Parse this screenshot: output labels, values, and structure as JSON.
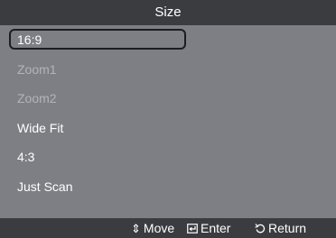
{
  "title": "Size",
  "items": [
    {
      "label": "16:9",
      "state": "selected"
    },
    {
      "label": "Zoom1",
      "state": "disabled"
    },
    {
      "label": "Zoom2",
      "state": "disabled"
    },
    {
      "label": "Wide Fit",
      "state": "enabled"
    },
    {
      "label": "4:3",
      "state": "enabled"
    },
    {
      "label": "Just Scan",
      "state": "enabled"
    }
  ],
  "footer": {
    "move": {
      "icon": "up-down-arrow-icon",
      "label": "Move"
    },
    "enter": {
      "icon": "enter-icon",
      "label": "Enter"
    },
    "return": {
      "icon": "return-icon",
      "label": "Return"
    }
  },
  "colors": {
    "panel": "#7d7f84",
    "bar": "#3a3c40",
    "text": "#ffffff",
    "disabled_text": "#b2b4b8",
    "selection_border": "#1b1d22"
  }
}
